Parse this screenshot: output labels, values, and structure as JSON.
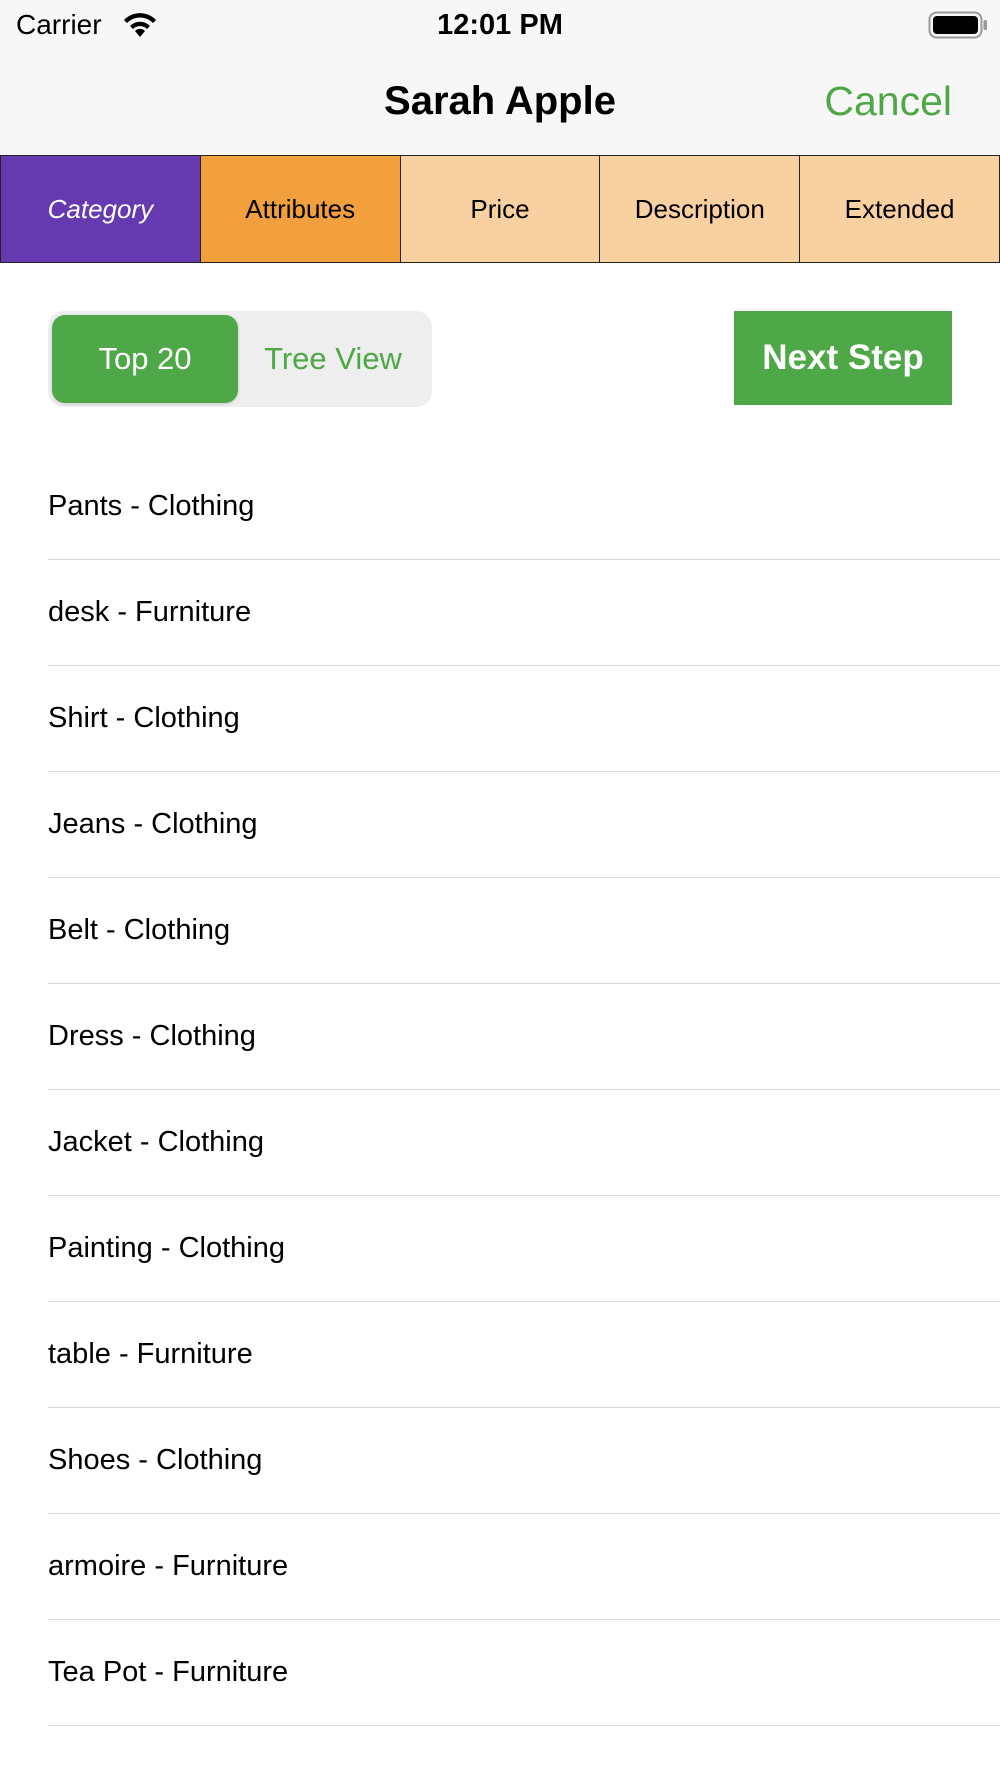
{
  "status_bar": {
    "carrier": "Carrier",
    "time": "12:01 PM",
    "wifi_icon": "wifi-icon",
    "battery_icon": "battery-icon"
  },
  "nav": {
    "title": "Sarah Apple",
    "cancel_label": "Cancel"
  },
  "steps": [
    {
      "label": "Category",
      "state": "active"
    },
    {
      "label": "Attributes",
      "state": "done"
    },
    {
      "label": "Price",
      "state": "pending"
    },
    {
      "label": "Description",
      "state": "pending"
    },
    {
      "label": "Extended",
      "state": "pending"
    }
  ],
  "view_toggle": {
    "options": [
      "Top 20",
      "Tree View"
    ],
    "selected": "Top 20"
  },
  "next_step_label": "Next Step",
  "categories": [
    "Pants - Clothing",
    "desk - Furniture",
    "Shirt - Clothing",
    "Jeans - Clothing",
    "Belt - Clothing",
    "Dress - Clothing",
    "Jacket - Clothing",
    "Painting - Clothing",
    "table - Furniture",
    "Shoes - Clothing",
    "armoire - Furniture",
    "Tea Pot - Furniture"
  ],
  "colors": {
    "accent_green": "#4fa847",
    "active_step": "#653ab0",
    "done_step": "#f2a03e",
    "pending_step": "#f9d09f"
  }
}
